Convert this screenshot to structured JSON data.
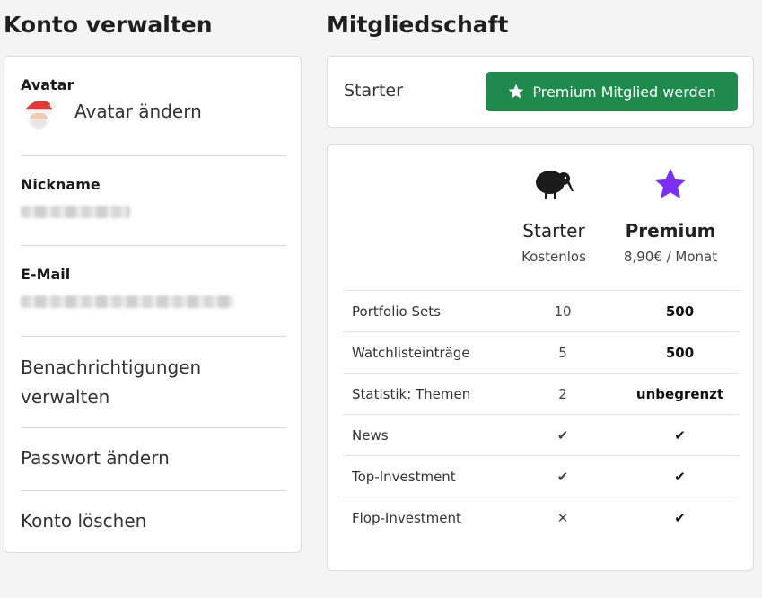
{
  "account": {
    "title": "Konto verwalten",
    "avatar_label": "Avatar",
    "avatar_change": "Avatar ändern",
    "nickname_label": "Nickname",
    "email_label": "E-Mail",
    "notifications_link": "Benachrichtigungen verwalten",
    "password_link": "Passwort ändern",
    "delete_link": "Konto löschen"
  },
  "membership": {
    "title": "Mitgliedschaft",
    "current_plan": "Starter",
    "upgrade_button": "Premium Mitglied werden",
    "button_color": "#1f8a4c"
  },
  "plans": {
    "starter": {
      "name": "Starter",
      "price": "Kostenlos",
      "icon": "kiwi-bird-icon"
    },
    "premium": {
      "name": "Premium",
      "price": "8,90€ / Monat",
      "icon": "star-icon",
      "icon_color": "#7b2ff2"
    }
  },
  "features": [
    {
      "name": "Portfolio Sets",
      "starter": "10",
      "premium": "500"
    },
    {
      "name": "Watchlisteinträge",
      "starter": "5",
      "premium": "500"
    },
    {
      "name": "Statistik: Themen",
      "starter": "2",
      "premium": "unbegrenzt"
    },
    {
      "name": "News",
      "starter": "✔",
      "premium": "✔"
    },
    {
      "name": "Top-Investment",
      "starter": "✔",
      "premium": "✔"
    },
    {
      "name": "Flop-Investment",
      "starter": "✕",
      "premium": "✔"
    }
  ]
}
